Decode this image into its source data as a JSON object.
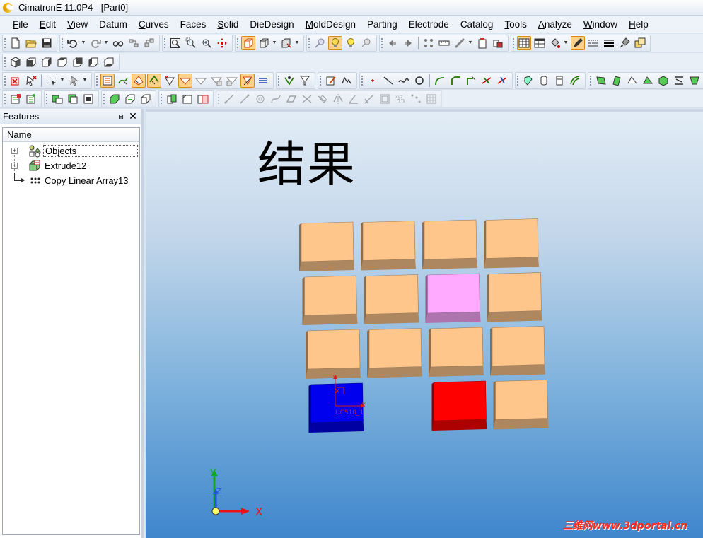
{
  "window": {
    "title": "CimatronE 11.0P4 - [Part0]"
  },
  "menu": [
    {
      "label": "File",
      "ul": "F",
      "rest": "ile"
    },
    {
      "label": "Edit",
      "ul": "E",
      "rest": "dit"
    },
    {
      "label": "View",
      "ul": "V",
      "rest": "iew"
    },
    {
      "label": "Datum",
      "ul": "",
      "rest": "Datum"
    },
    {
      "label": "Curves",
      "ul": "C",
      "rest": "urves"
    },
    {
      "label": "Faces",
      "ul": "",
      "rest": "Faces"
    },
    {
      "label": "Solid",
      "ul": "S",
      "rest": "olid"
    },
    {
      "label": "DieDesign",
      "ul": "",
      "rest": "DieDesign"
    },
    {
      "label": "MoldDesign",
      "ul": "M",
      "rest": "oldDesign"
    },
    {
      "label": "Parting",
      "ul": "",
      "rest": "Parting"
    },
    {
      "label": "Electrode",
      "ul": "",
      "rest": "Electrode"
    },
    {
      "label": "Catalog",
      "ul": "",
      "rest": "Catalog"
    },
    {
      "label": "Tools",
      "ul": "T",
      "rest": "ools"
    },
    {
      "label": "Analyze",
      "ul": "A",
      "rest": "nalyze"
    },
    {
      "label": "Window",
      "ul": "W",
      "rest": "indow"
    },
    {
      "label": "Help",
      "ul": "H",
      "rest": "elp"
    }
  ],
  "features_panel": {
    "title": "Features",
    "pin_glyph": "⩎",
    "close_glyph": "✕",
    "column_header": "Name",
    "items": [
      {
        "label": "Objects",
        "expander": "+",
        "icon": "objects-icon"
      },
      {
        "label": "Extrude12",
        "expander": "+",
        "icon": "extrude-icon"
      },
      {
        "label": "Copy Linear Array13",
        "expander": "",
        "icon": "linear-array-icon"
      }
    ]
  },
  "viewport": {
    "caption": "结果",
    "ucs_label": "UCS10_1",
    "axis_x": "X",
    "axis_y": "Y",
    "axis_z": "Z",
    "ucs_axis_x": "X",
    "ucs_axis_y": "Y",
    "watermark": "三维网www.3dportal.cn"
  },
  "colors": {
    "block_default": "#ffc68c",
    "block_highlight": "#ffaaff",
    "block_blue": "#0000ee",
    "block_red": "#ff0000",
    "axis_x": "#ee1111",
    "axis_y": "#11aa22",
    "axis_z": "#2255dd"
  },
  "blocks": [
    [
      "default",
      "default",
      "default",
      "default"
    ],
    [
      "default",
      "default",
      "highlight",
      "default"
    ],
    [
      "default",
      "default",
      "default",
      "default"
    ],
    [
      "blue",
      "empty",
      "red",
      "default"
    ]
  ]
}
